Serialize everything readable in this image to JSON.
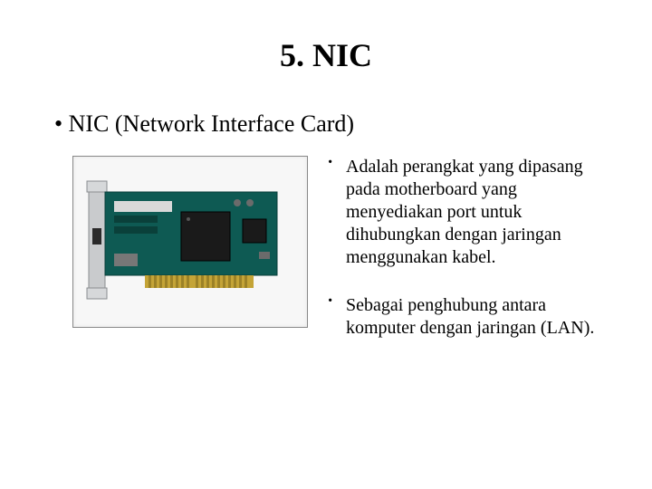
{
  "title": "5. NIC",
  "main_bullet": "NIC (Network Interface Card)",
  "image_alt": "Network Interface Card",
  "sub_bullets": [
    "Adalah perangkat yang dipasang pada motherboard yang menyediakan port untuk dihubungkan dengan jaringan menggunakan kabel.",
    "Sebagai penghubung antara komputer dengan jaringan (LAN)."
  ]
}
